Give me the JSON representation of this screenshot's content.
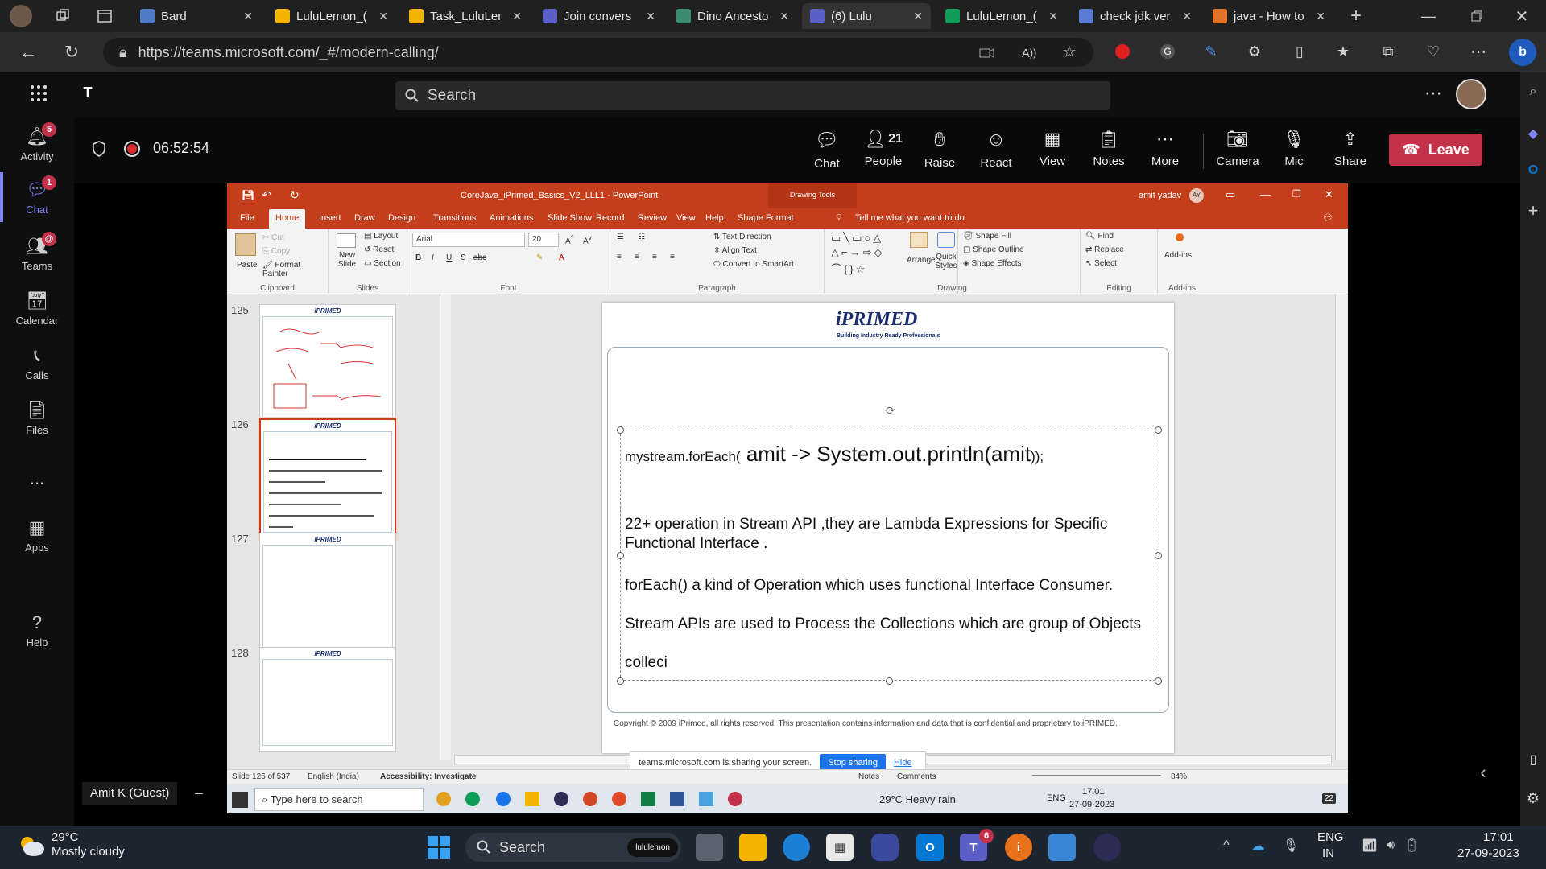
{
  "browser": {
    "tabs": [
      {
        "title": "Bard",
        "active": false,
        "color": "#4e7ac7"
      },
      {
        "title": "LuluLemon_(",
        "active": false,
        "color": "#f4b400"
      },
      {
        "title": "Task_LuluLen",
        "active": false,
        "color": "#f4b400"
      },
      {
        "title": "Join convers",
        "active": false,
        "color": "#5b5fc7"
      },
      {
        "title": "Dino Ancesto",
        "active": false,
        "color": "#3c8d6e"
      },
      {
        "title": "(6) Lulu",
        "active": true,
        "color": "#5b5fc7"
      },
      {
        "title": "LuluLemon_(",
        "active": false,
        "color": "#0f9d58"
      },
      {
        "title": "check jdk ver",
        "active": false,
        "color": "#5b7bd5"
      },
      {
        "title": "java - How to",
        "active": false,
        "color": "#e0742b"
      }
    ],
    "url": "https://teams.microsoft.com/_#/modern-calling/"
  },
  "teams": {
    "search_placeholder": "Search",
    "rail": [
      {
        "label": "Activity",
        "badge": "5"
      },
      {
        "label": "Chat",
        "badge": "1"
      },
      {
        "label": "Teams",
        "badge": "@"
      },
      {
        "label": "Calendar",
        "badge": ""
      },
      {
        "label": "Calls",
        "badge": ""
      },
      {
        "label": "Files",
        "badge": ""
      },
      {
        "label": "Apps",
        "badge": ""
      },
      {
        "label": "Help",
        "badge": ""
      }
    ],
    "more_dots": "...",
    "timer": "06:52:54",
    "controls": {
      "chat": "Chat",
      "people": "People",
      "people_count": "21",
      "raise": "Raise",
      "react": "React",
      "view": "View",
      "notes": "Notes",
      "more": "More",
      "camera": "Camera",
      "mic": "Mic",
      "share": "Share",
      "leave": "Leave"
    },
    "participant_name": "Amit K (Guest)"
  },
  "ppt": {
    "doc_title": "CoreJava_iPrimed_Basics_V2_LLL1 - PowerPoint",
    "context_tool": "Drawing Tools",
    "user": "amit yadav",
    "user_initials": "AY",
    "tabs": [
      "File",
      "Home",
      "Insert",
      "Draw",
      "Design",
      "Transitions",
      "Animations",
      "Slide Show",
      "Record",
      "Review",
      "View",
      "Help",
      "Shape Format"
    ],
    "tell_me": "Tell me what you want to do",
    "ribbon": {
      "paste": "Paste",
      "cut": "Cut",
      "copy": "Copy",
      "format_painter": "Format Painter",
      "clipboard": "Clipboard",
      "new_slide": "New Slide",
      "layout": "Layout",
      "reset": "Reset",
      "section": "Section",
      "slides": "Slides",
      "font_name": "Arial",
      "font_size": "20",
      "font": "Font",
      "text_direction": "Text Direction",
      "align_text": "Align Text",
      "convert_smartart": "Convert to SmartArt",
      "paragraph": "Paragraph",
      "arrange": "Arrange",
      "quick_styles": "Quick Styles",
      "shape_fill": "Shape Fill",
      "shape_outline": "Shape Outline",
      "shape_effects": "Shape Effects",
      "drawing": "Drawing",
      "find": "Find",
      "replace": "Replace",
      "select": "Select",
      "editing": "Editing",
      "addins": "Add-ins",
      "addins_group": "Add-ins"
    },
    "thumbs": [
      {
        "num": "125"
      },
      {
        "num": "126"
      },
      {
        "num": "127"
      },
      {
        "num": "128"
      }
    ],
    "thumb_logo": "iPRIMED",
    "slide": {
      "logo": "iPRIMED",
      "tagline": "Building Industry Ready Professionals",
      "line1_small": "mystream.forEach(",
      "line1_big": " amit -> System.out.println(amit",
      "line1_end": "));",
      "line2": "22+ operation in Stream API ,they are Lambda Expressions for Specific Functional Interface .",
      "line3": "forEach() a kind of Operation which uses functional Interface Consumer.",
      "line4": "Stream APIs are used to Process the Collections which are group of Objects",
      "line5": "colleci",
      "footer": "Copyright © 2009 iPrimed, all rights reserved. This presentation contains information  and data  that is confidential and proprietary to iPRIMED."
    },
    "sharing": {
      "text": "teams.microsoft.com is sharing your screen.",
      "stop": "Stop sharing",
      "hide": "Hide"
    },
    "status": {
      "slide": "Slide 126 of 537",
      "lang": "English (India)",
      "accessibility": "Accessibility: Investigate",
      "notes": "Notes",
      "comments": "Comments",
      "zoom": "84%"
    },
    "inner_taskbar": {
      "search": "Type here to search",
      "weather": "29°C  Heavy rain",
      "lang": "ENG",
      "time": "17:01",
      "date": "27-09-2023",
      "notif": "22"
    }
  },
  "taskbar": {
    "temp": "29°C",
    "weather": "Mostly cloudy",
    "search": "Search",
    "pill": "lululemon",
    "lang1": "ENG",
    "lang2": "IN",
    "time": "17:01",
    "date": "27-09-2023",
    "teams_badge": "6"
  }
}
